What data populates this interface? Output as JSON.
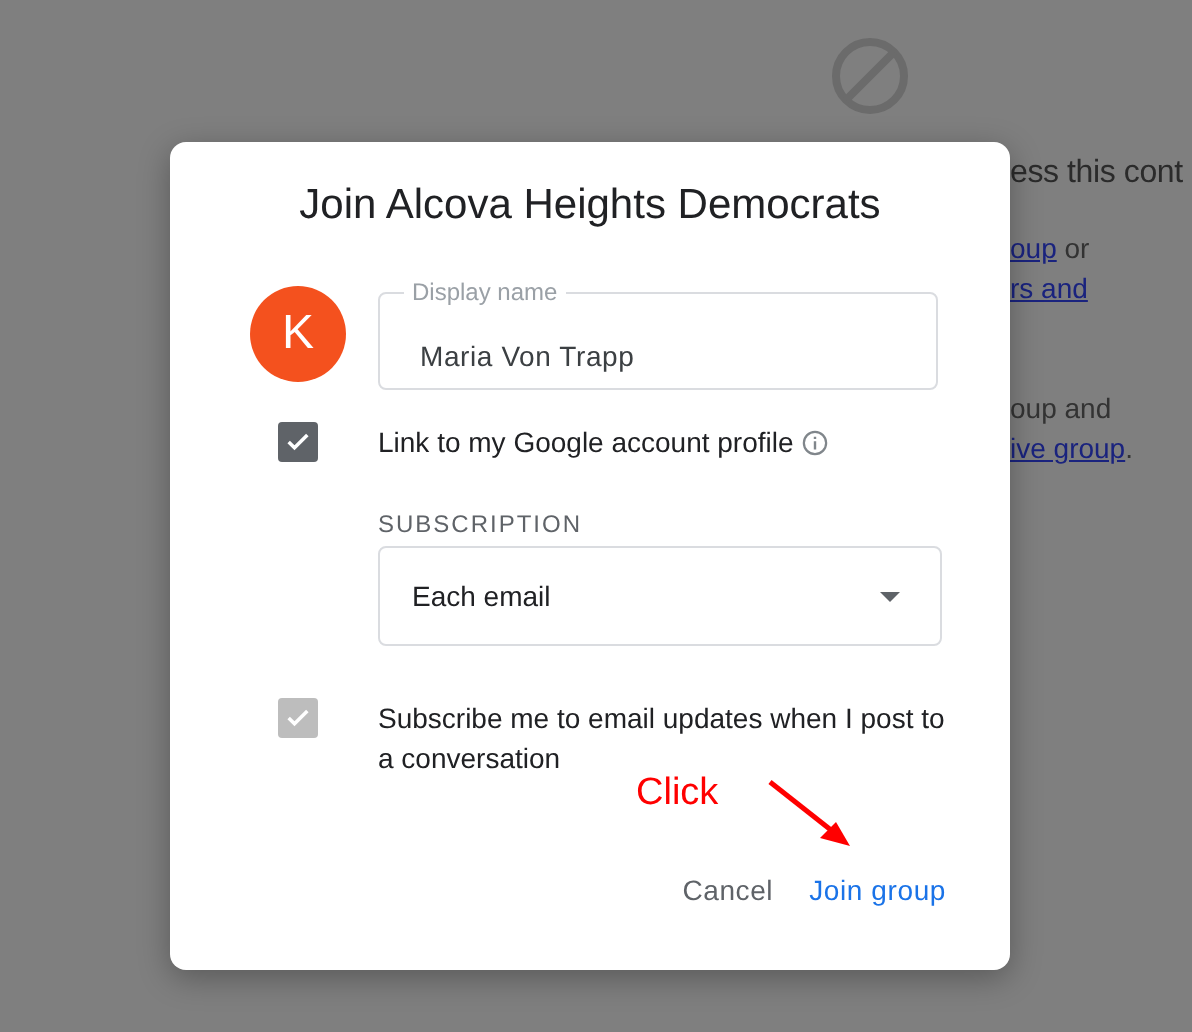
{
  "background": {
    "heading": "ess this cont",
    "lines": [
      {
        "parts": [
          {
            "text": "oup",
            "link": true
          },
          {
            "text": " or",
            "link": false
          }
        ]
      },
      {
        "parts": [
          {
            "text": "rs and",
            "link": true
          }
        ]
      },
      {
        "parts": [
          {
            "text": "oup and",
            "link": false
          }
        ]
      },
      {
        "parts": [
          {
            "text": "ive group",
            "link": true
          },
          {
            "text": ".",
            "link": false
          }
        ]
      }
    ]
  },
  "dialog": {
    "title": "Join Alcova Heights Democrats",
    "avatar": {
      "initial": "K",
      "color": "#f4511e"
    },
    "display_name": {
      "label": "Display name",
      "value": "Maria Von Trapp"
    },
    "link_profile": {
      "label": "Link to my Google account profile",
      "checked": true,
      "disabled": false
    },
    "subscription": {
      "label": "SUBSCRIPTION",
      "value": "Each email"
    },
    "subscribe_updates": {
      "label": "Subscribe me to email updates when I post to a conversation",
      "checked": true,
      "disabled": true
    },
    "buttons": [
      {
        "label": "Cancel",
        "primary": false
      },
      {
        "label": "Join group",
        "primary": true
      }
    ]
  },
  "annotation": {
    "label": "Click"
  }
}
